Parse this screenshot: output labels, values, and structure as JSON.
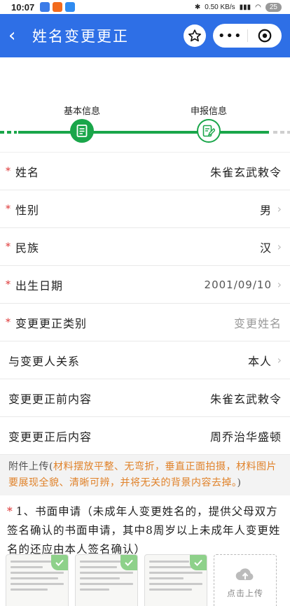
{
  "status": {
    "time": "10:07",
    "net": "0.50 KB/s",
    "battery": "25"
  },
  "nav": {
    "title": "姓名变更更正"
  },
  "steps": [
    {
      "label": "基本信息"
    },
    {
      "label": "申报信息"
    }
  ],
  "form": [
    {
      "label": "姓名",
      "value": "朱雀玄武敕令",
      "required": true
    },
    {
      "label": "性别",
      "value": "男",
      "required": true
    },
    {
      "label": "民族",
      "value": "汉",
      "required": true
    },
    {
      "label": "出生日期",
      "value": "2001/09/10",
      "required": true
    },
    {
      "label": "变更更正类别",
      "value": "变更姓名",
      "required": true
    },
    {
      "label": "与变更人关系",
      "value": "本人",
      "required": false
    },
    {
      "label": "变更更正前内容",
      "value": "朱雀玄武敕令",
      "required": false
    },
    {
      "label": "变更更正后内容",
      "value": "周乔治华盛顿",
      "required": false
    }
  ],
  "attachment": {
    "prefix": "附件上传(",
    "warning": "材料摆放平整、无弯折，垂直正面拍摄，材料图片要展现全貌、清晰可辨，并将无关的背景内容去掉。",
    "suffix": ")"
  },
  "requirement": {
    "text": "1、书面申请（未成年人变更姓名的，提供父母双方签名确认的书面申请，其中8周岁以上未成年人变更姓名的还应由本人签名确认）"
  },
  "upload": {
    "label": "点击上传"
  }
}
